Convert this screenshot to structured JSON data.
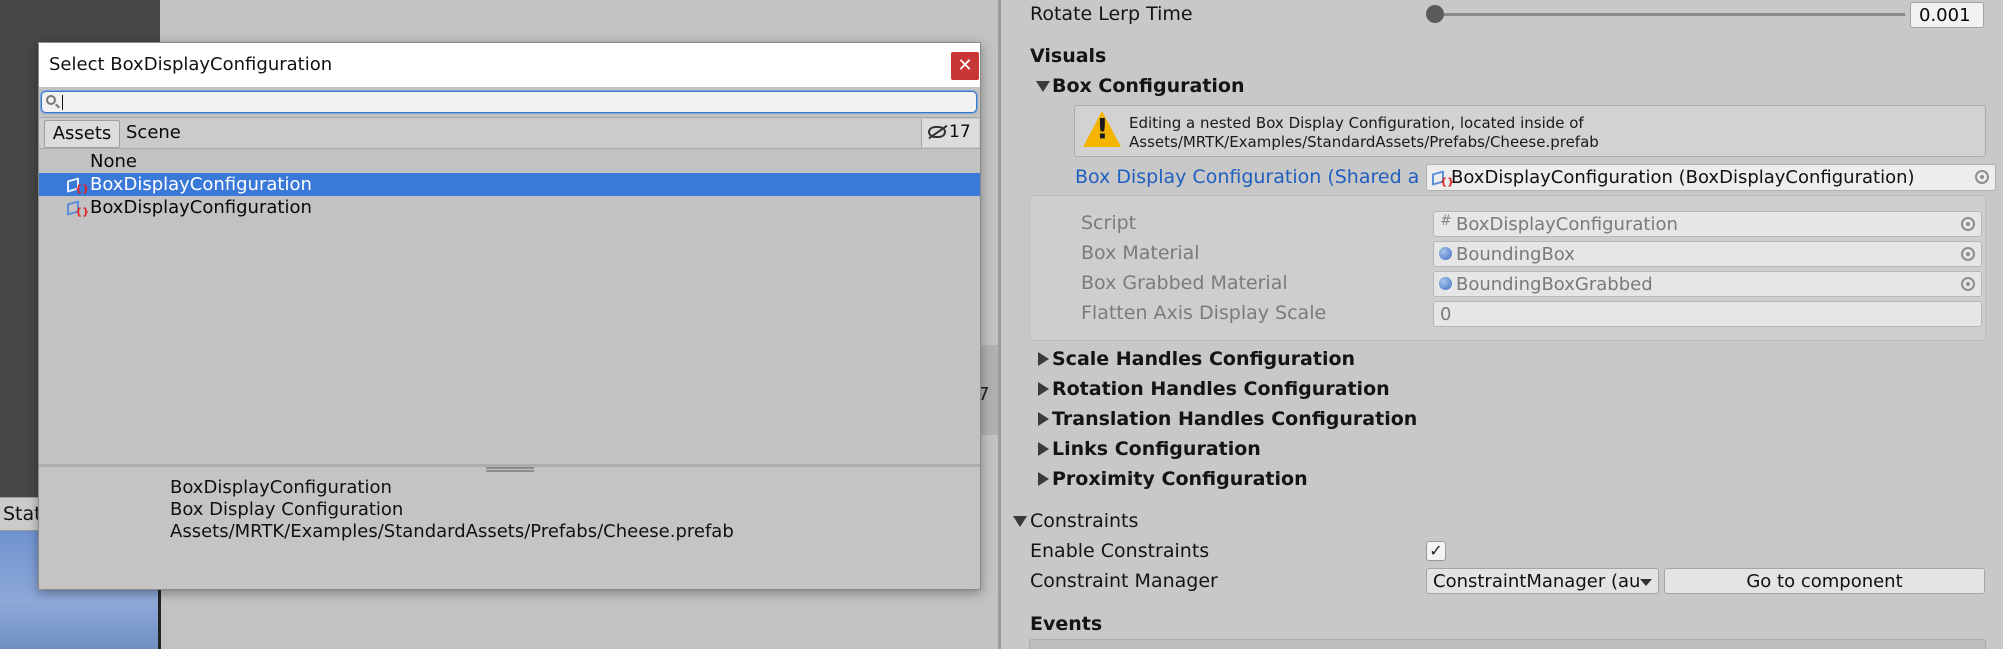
{
  "background": {
    "status_tab_label": "Stat",
    "middle_fragment": "7"
  },
  "inspector": {
    "rotate_lerp": {
      "label": "Rotate Lerp Time",
      "value": "0.001",
      "slider_fraction": 0.0
    },
    "visuals_header": "Visuals",
    "box_configuration": {
      "header": "Box Configuration",
      "help_line1": "Editing a nested Box Display Configuration, located inside of",
      "help_line2": "Assets/MRTK/Examples/StandardAssets/Prefabs/Cheese.prefab",
      "shared_label": "Box Display Configuration (Shared asse",
      "shared_value": "BoxDisplayConfiguration (BoxDisplayConfiguration)",
      "fields": [
        {
          "label": "Script",
          "value": "BoxDisplayConfiguration",
          "icon": "script-hash-icon"
        },
        {
          "label": "Box Material",
          "value": "BoundingBox",
          "icon": "material-sphere-icon"
        },
        {
          "label": "Box Grabbed Material",
          "value": "BoundingBoxGrabbed",
          "icon": "material-sphere-icon"
        },
        {
          "label": "Flatten Axis Display Scale",
          "value": "0",
          "icon": ""
        }
      ]
    },
    "collapsed_sections": [
      "Scale Handles Configuration",
      "Rotation Handles Configuration",
      "Translation Handles Configuration",
      "Links Configuration",
      "Proximity Configuration"
    ],
    "constraints": {
      "header": "Constraints",
      "enable_label": "Enable Constraints",
      "enable_checked": true,
      "manager_label": "Constraint Manager",
      "manager_value": "ConstraintManager (au",
      "go_button": "Go to component"
    },
    "events_header": "Events"
  },
  "picker": {
    "title": "Select BoxDisplayConfiguration",
    "close_glyph": "✕",
    "search_value": "",
    "tabs": [
      "Assets",
      "Scene"
    ],
    "hidden_count": "17",
    "items": [
      {
        "label": "None",
        "icon": "",
        "selected": false
      },
      {
        "label": "BoxDisplayConfiguration",
        "icon": "scriptable-object-icon",
        "selected": true
      },
      {
        "label": "BoxDisplayConfiguration",
        "icon": "scriptable-object-icon",
        "selected": false
      }
    ],
    "preview": {
      "name": "BoxDisplayConfiguration",
      "type": "Box Display Configuration",
      "path": "Assets/MRTK/Examples/StandardAssets/Prefabs/Cheese.prefab"
    }
  },
  "colors": {
    "selection_blue": "#3a79d8",
    "link_blue": "#1f5fbf",
    "warning_yellow": "#f4b400",
    "close_red": "#c93636"
  }
}
